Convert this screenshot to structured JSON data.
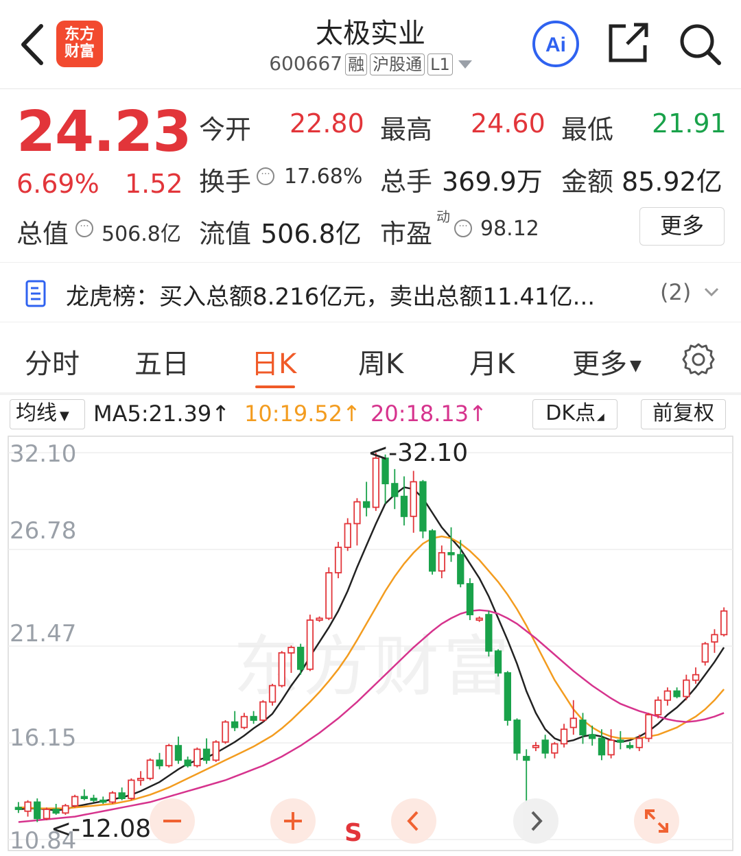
{
  "header": {
    "app_logo_text": "东方财富",
    "stock_name": "太极实业",
    "stock_code": "600667",
    "tags": [
      "融",
      "沪股通",
      "L1"
    ]
  },
  "quote": {
    "price": "24.23",
    "change_pct": "6.69%",
    "change": "1.52",
    "open_label": "今开",
    "open": "22.80",
    "high_label": "最高",
    "high": "24.60",
    "low_label": "最低",
    "low": "21.91",
    "turnover_label": "换手",
    "turnover": "17.68%",
    "volume_label": "总手",
    "volume": "369.9万",
    "amount_label": "金额",
    "amount": "85.92亿",
    "mktcap_label": "总值",
    "mktcap": "506.8亿",
    "float_label": "流值",
    "float": "506.8亿",
    "pe_label": "市盈",
    "pe_sup": "动",
    "pe": "98.12",
    "more_label": "更多"
  },
  "notice": {
    "text": "龙虎榜：买入总额8.216亿元，卖出总额11.41亿...",
    "count": "(2)"
  },
  "tabs": [
    "分时",
    "五日",
    "日K",
    "周K",
    "月K",
    "更多"
  ],
  "active_tab": "日K",
  "ma_row": {
    "dropdown_label": "均线",
    "ma5": "MA5:21.39↑",
    "ma10": "10:19.52↑",
    "ma20": "20:18.13↑",
    "dk_label": "DK点",
    "adjust_label": "前复权"
  },
  "colors": {
    "up": "#e2353a",
    "down": "#19a24a",
    "ma5": "#222222",
    "ma10": "#f39c1f",
    "ma20": "#d6338d",
    "accent": "#f05a28"
  },
  "chart_data": {
    "type": "candlestick",
    "y_ticks": [
      "32.10",
      "26.78",
      "21.47",
      "16.15",
      "10.84"
    ],
    "ylim": [
      10.84,
      32.1
    ],
    "annotations": {
      "high": "<-32.10",
      "low": "<-12.08"
    },
    "watermark": "东方财富",
    "signal_marker": "S",
    "candles": [
      [
        12.6,
        12.9,
        12.3,
        12.5
      ],
      [
        12.4,
        13.0,
        12.1,
        12.9
      ],
      [
        12.9,
        13.1,
        11.8,
        12.0
      ],
      [
        12.0,
        12.6,
        11.9,
        12.5
      ],
      [
        12.5,
        12.8,
        12.2,
        12.3
      ],
      [
        12.3,
        12.8,
        12.2,
        12.7
      ],
      [
        12.7,
        13.3,
        12.6,
        13.2
      ],
      [
        13.2,
        13.6,
        13.0,
        13.1
      ],
      [
        13.1,
        13.3,
        12.9,
        13.0
      ],
      [
        13.0,
        13.2,
        12.8,
        12.9
      ],
      [
        12.9,
        13.5,
        12.8,
        13.4
      ],
      [
        13.4,
        13.7,
        13.0,
        13.1
      ],
      [
        13.1,
        14.2,
        13.0,
        14.1
      ],
      [
        14.1,
        14.6,
        13.8,
        14.2
      ],
      [
        14.2,
        15.3,
        14.1,
        15.2
      ],
      [
        15.2,
        15.6,
        14.7,
        14.9
      ],
      [
        14.9,
        16.1,
        14.8,
        16.0
      ],
      [
        16.0,
        16.5,
        15.0,
        15.2
      ],
      [
        15.2,
        15.4,
        14.8,
        14.9
      ],
      [
        14.9,
        15.9,
        14.8,
        15.8
      ],
      [
        15.8,
        16.4,
        15.0,
        15.2
      ],
      [
        15.2,
        16.3,
        15.1,
        16.2
      ],
      [
        16.2,
        17.4,
        16.1,
        17.3
      ],
      [
        17.3,
        17.9,
        16.8,
        17.0
      ],
      [
        17.0,
        17.8,
        16.9,
        17.6
      ],
      [
        17.6,
        17.9,
        17.2,
        17.4
      ],
      [
        17.4,
        18.5,
        17.3,
        18.4
      ],
      [
        18.4,
        19.4,
        18.2,
        19.3
      ],
      [
        19.3,
        21.2,
        19.2,
        21.1
      ],
      [
        21.1,
        21.5,
        20.0,
        21.4
      ],
      [
        21.4,
        21.6,
        19.9,
        20.2
      ],
      [
        20.2,
        23.2,
        20.1,
        22.9
      ],
      [
        22.9,
        23.1,
        22.8,
        23.0
      ],
      [
        23.0,
        25.8,
        22.9,
        25.5
      ],
      [
        25.5,
        27.2,
        25.2,
        26.9
      ],
      [
        26.9,
        28.5,
        26.7,
        28.2
      ],
      [
        28.2,
        29.6,
        27.0,
        29.4
      ],
      [
        29.4,
        30.5,
        28.6,
        29.1
      ],
      [
        29.1,
        32.1,
        28.9,
        31.8
      ],
      [
        31.8,
        32.0,
        29.3,
        30.4
      ],
      [
        30.4,
        31.2,
        29.0,
        29.7
      ],
      [
        29.7,
        30.8,
        28.1,
        28.6
      ],
      [
        28.6,
        31.1,
        27.7,
        30.5
      ],
      [
        30.5,
        30.6,
        27.4,
        27.8
      ],
      [
        27.8,
        27.9,
        25.4,
        25.6
      ],
      [
        25.6,
        27.0,
        25.2,
        26.6
      ],
      [
        26.6,
        28.0,
        26.1,
        26.5
      ],
      [
        26.5,
        27.3,
        24.7,
        24.9
      ],
      [
        24.9,
        25.2,
        22.9,
        23.2
      ],
      [
        22.9,
        23.1,
        22.8,
        23.0
      ],
      [
        23.2,
        23.4,
        20.9,
        21.2
      ],
      [
        21.2,
        21.3,
        19.8,
        20.0
      ],
      [
        20.0,
        20.1,
        17.1,
        17.4
      ],
      [
        17.4,
        17.5,
        15.2,
        15.6
      ],
      [
        15.4,
        15.8,
        12.9,
        15.2
      ],
      [
        15.9,
        16.2,
        15.7,
        16.0
      ],
      [
        16.3,
        16.6,
        15.3,
        15.6
      ],
      [
        15.6,
        16.2,
        15.3,
        16.1
      ],
      [
        16.1,
        17.2,
        15.9,
        16.9
      ],
      [
        17.0,
        18.5,
        16.6,
        17.5
      ],
      [
        17.4,
        17.8,
        16.1,
        16.6
      ],
      [
        16.6,
        17.1,
        16.0,
        16.4
      ],
      [
        16.4,
        16.9,
        15.2,
        15.5
      ],
      [
        15.5,
        16.9,
        15.3,
        16.3
      ],
      [
        16.3,
        16.8,
        15.8,
        16.2
      ],
      [
        16.0,
        16.2,
        15.8,
        15.9
      ],
      [
        15.9,
        16.6,
        15.7,
        16.4
      ],
      [
        16.4,
        17.8,
        16.2,
        17.7
      ],
      [
        17.7,
        18.7,
        17.5,
        18.5
      ],
      [
        18.5,
        19.2,
        18.2,
        19.0
      ],
      [
        19.0,
        19.2,
        18.6,
        18.7
      ],
      [
        18.7,
        19.9,
        18.5,
        19.6
      ],
      [
        19.6,
        20.3,
        19.4,
        19.9
      ],
      [
        20.6,
        21.7,
        20.4,
        21.6
      ],
      [
        21.7,
        22.4,
        21.1,
        22.1
      ],
      [
        22.1,
        23.6,
        22.0,
        23.4
      ]
    ],
    "ma_series": {
      "MA5": [
        12.5,
        12.55,
        12.55,
        12.5,
        12.45,
        12.5,
        12.65,
        12.75,
        12.85,
        12.95,
        13.05,
        13.15,
        13.3,
        13.5,
        13.75,
        14.0,
        14.35,
        14.7,
        15.0,
        15.2,
        15.35,
        15.6,
        15.9,
        16.2,
        16.55,
        16.95,
        17.3,
        17.75,
        18.5,
        19.3,
        20.0,
        20.9,
        21.7,
        22.5,
        23.4,
        24.5,
        25.8,
        27.0,
        28.2,
        29.3,
        29.8,
        30.2,
        30.1,
        29.6,
        28.8,
        28.0,
        27.4,
        26.8,
        26.0,
        25.2,
        24.2,
        23.0,
        21.8,
        20.5,
        19.0,
        17.8,
        16.9,
        16.4,
        16.2,
        16.3,
        16.5,
        16.6,
        16.5,
        16.3,
        16.2,
        16.3,
        16.5,
        16.8,
        17.2,
        17.7,
        18.1,
        18.6,
        19.2,
        19.9,
        20.6,
        21.4
      ],
      "MA10": [
        12.6,
        12.6,
        12.55,
        12.55,
        12.55,
        12.55,
        12.6,
        12.65,
        12.7,
        12.75,
        12.8,
        12.9,
        13.0,
        13.15,
        13.3,
        13.5,
        13.7,
        13.95,
        14.2,
        14.45,
        14.7,
        14.95,
        15.2,
        15.45,
        15.7,
        15.95,
        16.25,
        16.55,
        16.95,
        17.4,
        17.9,
        18.4,
        18.95,
        19.55,
        20.2,
        20.95,
        21.8,
        22.7,
        23.6,
        24.5,
        25.3,
        26.0,
        26.6,
        27.1,
        27.4,
        27.5,
        27.4,
        27.1,
        26.7,
        26.2,
        25.6,
        25.0,
        24.3,
        23.5,
        22.6,
        21.6,
        20.6,
        19.6,
        18.8,
        18.0,
        17.4,
        17.0,
        16.7,
        16.5,
        16.4,
        16.4,
        16.4,
        16.5,
        16.6,
        16.8,
        17.0,
        17.3,
        17.6,
        18.0,
        18.5,
        19.1
      ],
      "MA20": [
        11.8,
        11.85,
        11.9,
        11.95,
        12.0,
        12.05,
        12.1,
        12.2,
        12.3,
        12.4,
        12.5,
        12.6,
        12.7,
        12.8,
        12.9,
        13.05,
        13.2,
        13.35,
        13.5,
        13.65,
        13.8,
        13.95,
        14.1,
        14.3,
        14.5,
        14.7,
        14.9,
        15.15,
        15.4,
        15.7,
        16.0,
        16.35,
        16.7,
        17.1,
        17.5,
        17.95,
        18.4,
        18.9,
        19.4,
        19.9,
        20.4,
        20.9,
        21.4,
        21.85,
        22.3,
        22.7,
        23.0,
        23.25,
        23.4,
        23.45,
        23.4,
        23.25,
        23.0,
        22.7,
        22.3,
        21.9,
        21.45,
        21.0,
        20.55,
        20.1,
        19.7,
        19.3,
        18.95,
        18.6,
        18.3,
        18.1,
        17.9,
        17.75,
        17.6,
        17.45,
        17.35,
        17.3,
        17.35,
        17.45,
        17.6,
        17.8
      ]
    }
  }
}
